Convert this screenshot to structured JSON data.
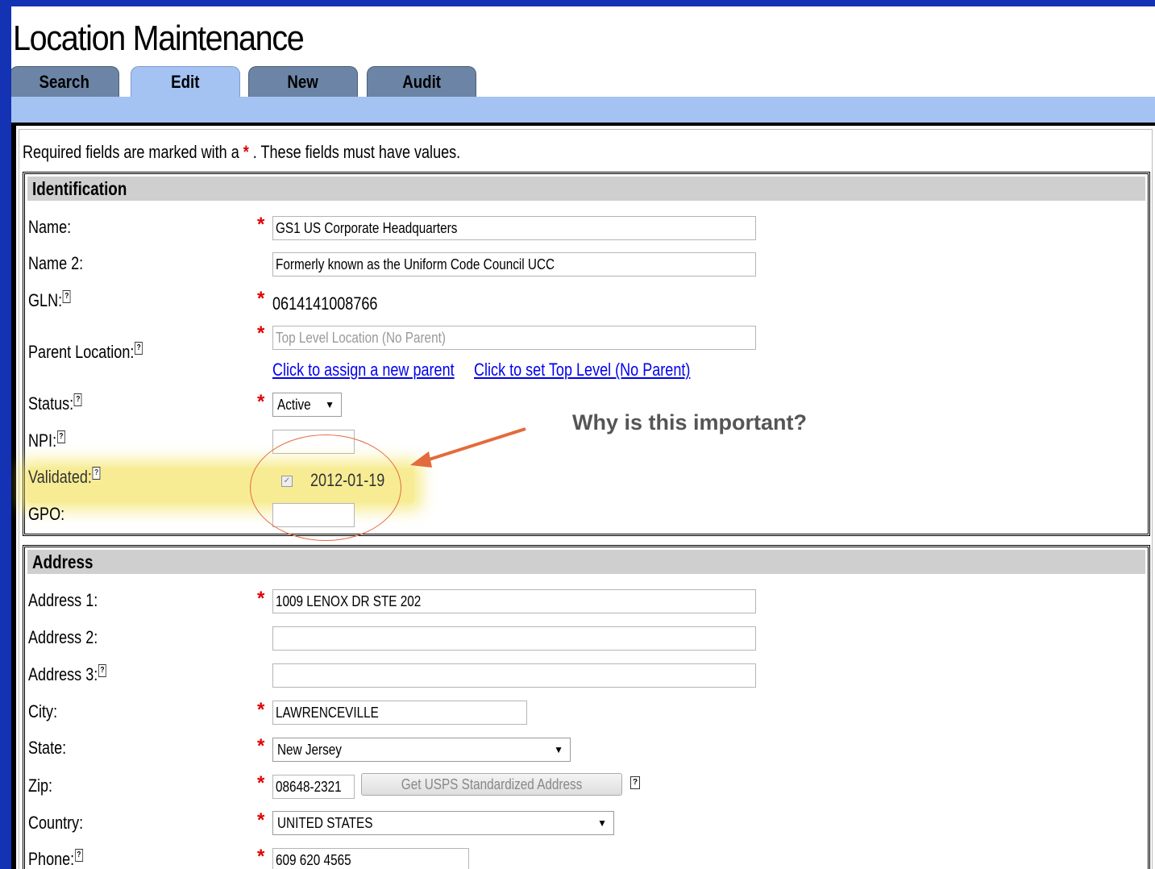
{
  "page": {
    "title": "Location Maintenance"
  },
  "tabs": [
    {
      "label": "Search"
    },
    {
      "label": "Edit"
    },
    {
      "label": "New"
    },
    {
      "label": "Audit"
    }
  ],
  "note": {
    "prefix": "Required fields are marked with a",
    "star": "*",
    "suffix": ". These fields must have values."
  },
  "help_glyph": "?",
  "req_glyph": "*",
  "identification": {
    "title": "Identification",
    "name_label": "Name:",
    "name_value": "GS1 US Corporate Headquarters",
    "name2_label": "Name 2:",
    "name2_value": "Formerly known as the Uniform Code Council UCC",
    "gln_label": "GLN:",
    "gln_value": "0614141008766",
    "parent_label": "Parent Location:",
    "parent_placeholder": "Top Level Location (No Parent)",
    "assign_parent_link": "Click to assign a new parent",
    "top_level_link": "Click to set Top Level (No Parent)",
    "status_label": "Status:",
    "status_value": "Active",
    "npi_label": "NPI:",
    "npi_value": "",
    "validated_label": "Validated:",
    "validated_checked": true,
    "validated_checkmark": "✓",
    "validated_date": "2012-01-19",
    "gpo_label": "GPO:",
    "gpo_value": ""
  },
  "callout": {
    "text": "Why is this important?"
  },
  "address": {
    "title": "Address",
    "address1_label": "Address 1:",
    "address1_value": "1009 LENOX DR STE 202",
    "address2_label": "Address 2:",
    "address2_value": "",
    "address3_label": "Address 3:",
    "address3_value": "",
    "city_label": "City:",
    "city_value": "LAWRENCEVILLE",
    "state_label": "State:",
    "state_value": "New Jersey",
    "zip_label": "Zip:",
    "zip_value": "08648-2321",
    "usps_button": "Get USPS Standardized Address",
    "country_label": "Country:",
    "country_value": "UNITED STATES",
    "phone_label": "Phone:",
    "phone_value": "609 620 4565"
  },
  "colors": {
    "frame": "#1432b4",
    "tab_bar": "#a4c3f3",
    "required": "#e00000",
    "callout_arrow": "#e36b3c",
    "highlight": "#f0dc3c"
  }
}
